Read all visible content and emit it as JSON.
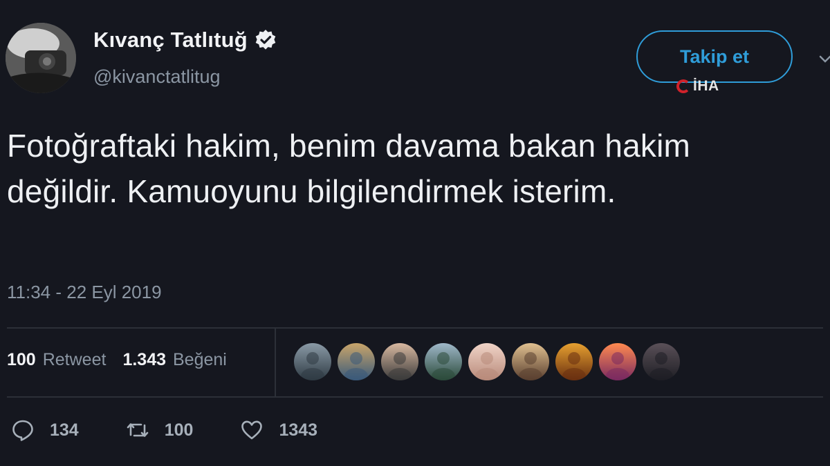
{
  "user": {
    "display_name": "Kıvanç Tatlıtuğ",
    "handle": "@kivanctatlitug",
    "verified": true
  },
  "follow_button": {
    "label": "Takip et"
  },
  "watermark": {
    "text": "İHA"
  },
  "tweet": {
    "text": "Fotoğraftaki hakim, benim davama bakan hakim değildir. Kamuoyunu bilgilendirmek isterim.",
    "timestamp": "11:34 - 22 Eyl 2019"
  },
  "stats": {
    "retweets_count": "100",
    "retweets_label": "Retweet",
    "likes_count": "1.343",
    "likes_label": "Beğeni"
  },
  "likers": [
    {
      "name": "liker-avatar-1",
      "c1": "#8a9aa6",
      "c2": "#2f3b44"
    },
    {
      "name": "liker-avatar-2",
      "c1": "#c9a56a",
      "c2": "#3a5a7a"
    },
    {
      "name": "liker-avatar-3",
      "c1": "#d8b8a0",
      "c2": "#3b3b3b"
    },
    {
      "name": "liker-avatar-4",
      "c1": "#9fb8c9",
      "c2": "#2b4a3a"
    },
    {
      "name": "liker-avatar-5",
      "c1": "#f0d4c8",
      "c2": "#b88a7a"
    },
    {
      "name": "liker-avatar-6",
      "c1": "#e0c090",
      "c2": "#5a4030"
    },
    {
      "name": "liker-avatar-7",
      "c1": "#e6a030",
      "c2": "#6a3010"
    },
    {
      "name": "liker-avatar-8",
      "c1": "#ff8a50",
      "c2": "#7a2a60"
    },
    {
      "name": "liker-avatar-9",
      "c1": "#5a5058",
      "c2": "#1e1e24"
    }
  ],
  "actions": {
    "replies": "134",
    "retweets": "100",
    "likes": "1343"
  },
  "colors": {
    "accent": "#2f9dd9",
    "background": "#15171f",
    "muted_text": "#8b96a3",
    "iha_red": "#d0222b"
  }
}
